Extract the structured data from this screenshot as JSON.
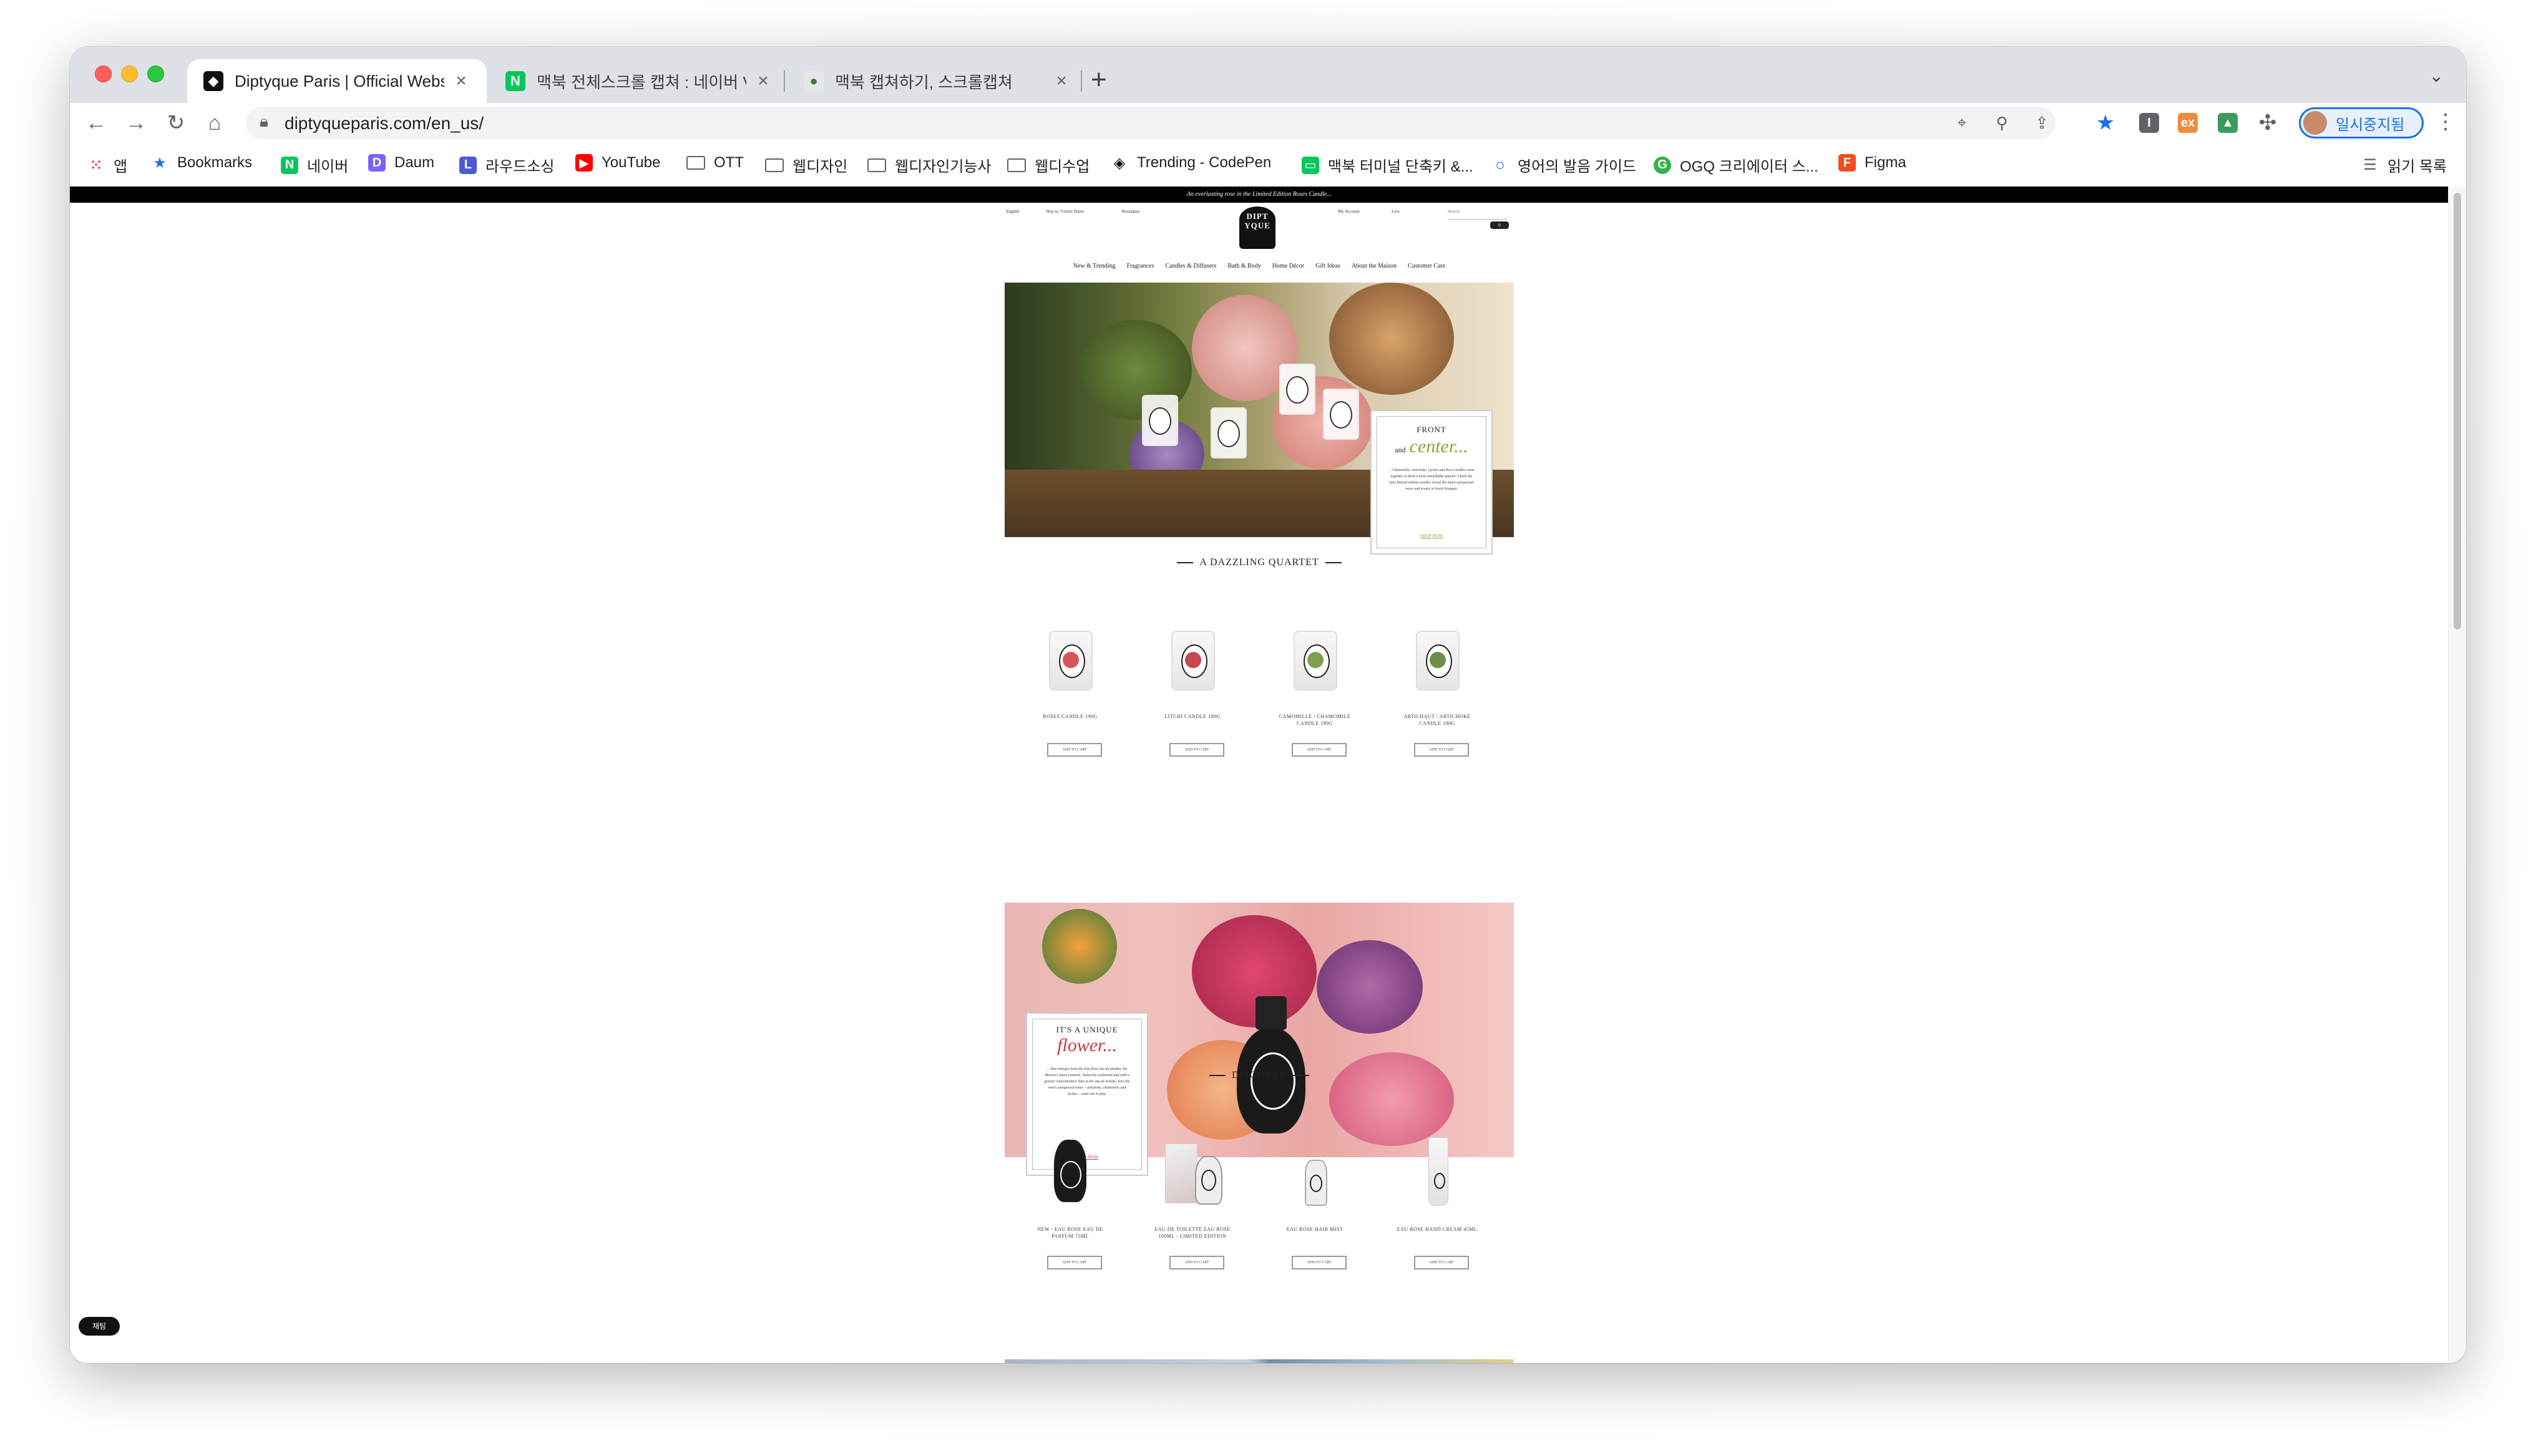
{
  "browser": {
    "tabs": [
      {
        "title": "Diptyque Paris | Official Websit",
        "active": true,
        "favicon": "diptyque-favicon"
      },
      {
        "title": "맥북 전체스크롤 캡쳐 : 네이버 VIEW",
        "active": false,
        "favicon": "naver-favicon"
      },
      {
        "title": "맥북 캡쳐하기, 스크롤캡쳐",
        "active": false,
        "favicon": "blog-favicon"
      }
    ],
    "new_tab_label": "+",
    "url": "diptyqueparis.com/en_us/",
    "profile_label": "일시중지됨",
    "bookmarks": [
      {
        "label": "앱",
        "icon": "apps-grid-icon"
      },
      {
        "label": "Bookmarks",
        "icon": "star-icon"
      },
      {
        "label": "네이버",
        "icon": "naver-icon"
      },
      {
        "label": "Daum",
        "icon": "daum-icon"
      },
      {
        "label": "라우드소싱",
        "icon": "loudsourcing-icon"
      },
      {
        "label": "YouTube",
        "icon": "youtube-icon"
      },
      {
        "label": "OTT",
        "icon": "folder-icon"
      },
      {
        "label": "웹디자인",
        "icon": "folder-icon"
      },
      {
        "label": "웹디자인기능사",
        "icon": "folder-icon"
      },
      {
        "label": "웹디수업",
        "icon": "folder-icon"
      },
      {
        "label": "Trending - CodePen",
        "icon": "codepen-icon"
      },
      {
        "label": "맥북 터미널 단축키 &...",
        "icon": "chat-icon"
      },
      {
        "label": "영어의 발음 가이드",
        "icon": "circle-icon"
      },
      {
        "label": "OGQ 크리에이터 스...",
        "icon": "ogq-icon"
      },
      {
        "label": "Figma",
        "icon": "figma-icon"
      }
    ],
    "reading_list_label": "읽기 목록",
    "colors": {
      "accent": "#1a73e8",
      "tabstrip": "#dee1e6"
    }
  },
  "site": {
    "announcement": "An everlasting rose in the Limited Edition Roses Candle...",
    "utility": {
      "language": "English",
      "ship_to": "Ship to: United States",
      "boutiques": "Boutiques",
      "account": "My Account",
      "live": "Live",
      "search": "Search"
    },
    "logo_text": "DIPTYQUE",
    "nav": [
      "New & Trending",
      "Fragrances",
      "Candles & Diffusers",
      "Bath & Body",
      "Home Décor",
      "Gift Ideas",
      "About the Maison",
      "Customer Care"
    ],
    "hero1": {
      "kicker": "FRONT",
      "and": "and",
      "headline": "center...",
      "body": "... Chamomile, Artichoke, Lychee and Rose candles come together to form a most remarkable quartet. Check the four limited edition candles reveal the much unexpected notes and scents in lovely bouquet.",
      "link": "SHOP NOW"
    },
    "section1_title": "A DAZZLING QUARTET",
    "quartet": [
      {
        "name": "ROSES CANDLE 190G",
        "button": "ADD TO CART"
      },
      {
        "name": "LITCHI CANDLE 190G",
        "button": "ADD TO CART"
      },
      {
        "name": "CAMOMILLE / CHAMOMILE CANDLE 190G",
        "button": "ADD TO CART"
      },
      {
        "name": "ARTICHAUT / ARTICHOKE CANDLE 190G",
        "button": "ADD TO CART"
      }
    ],
    "hero2": {
      "kicker": "IT'S A UNIQUE",
      "headline": "flower...",
      "body": "... that emerges from the Eau Rose eau de parfum, the Maison's latest creation. Naturally exuberant and with a greater concentration than in the eau de toilette, here the rose's unexpected notes – artichoke, chamomile and lychee – come out to play.",
      "link": "SHOP NOW"
    },
    "section2_title": "DISCOVER",
    "discover": [
      {
        "name": "NEW - EAU ROSE EAU DE PARFUM 75ML",
        "button": "ADD TO CART"
      },
      {
        "name": "EAU DE TOILETTE EAU ROSE 100ML - LIMITED EDITION",
        "button": "ADD TO CART"
      },
      {
        "name": "EAU ROSE HAIR MIST",
        "button": "ADD TO CART"
      },
      {
        "name": "EAU ROSE HAND CREAM 45ML",
        "button": "ADD TO CART"
      }
    ],
    "chat_label": "채팅",
    "cart_count": "0"
  }
}
